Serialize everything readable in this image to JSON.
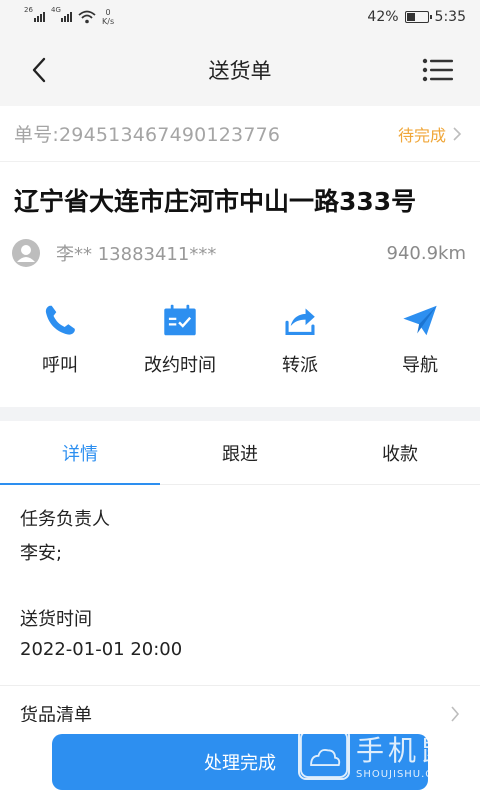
{
  "status_bar": {
    "signal1": "26",
    "signal2": "4G",
    "speed_value": "0",
    "speed_unit": "K/s",
    "battery_percent": "42%",
    "battery_level": 0.42,
    "time": "5:35"
  },
  "nav": {
    "title": "送货单",
    "back_icon": "chevron-left-icon",
    "menu_icon": "list-menu-icon"
  },
  "order": {
    "number": "单号:294513467490123776",
    "status": "待完成",
    "address": "辽宁省大连市庄河市中山一路333号",
    "contact": "李** 13883411***",
    "distance": "940.9km"
  },
  "actions": [
    {
      "label": "呼叫",
      "icon": "phone-icon"
    },
    {
      "label": "改约时间",
      "icon": "calendar-check-icon"
    },
    {
      "label": "转派",
      "icon": "share-icon"
    },
    {
      "label": "导航",
      "icon": "send-icon"
    }
  ],
  "tabs": [
    {
      "label": "详情"
    },
    {
      "label": "跟进"
    },
    {
      "label": "收款"
    }
  ],
  "details": {
    "owner_label": "任务负责人",
    "owner_value": "李安;",
    "time_label": "送货时间",
    "time_value": "2022-01-01 20:00",
    "goods_label": "货品清单"
  },
  "footer": {
    "button_label": "处理完成"
  },
  "watermark": {
    "big": "手机鼠",
    "small": "SHOUJISHU.COM"
  },
  "colors": {
    "accent": "#2d8ff0",
    "status": "#f0a73a"
  }
}
